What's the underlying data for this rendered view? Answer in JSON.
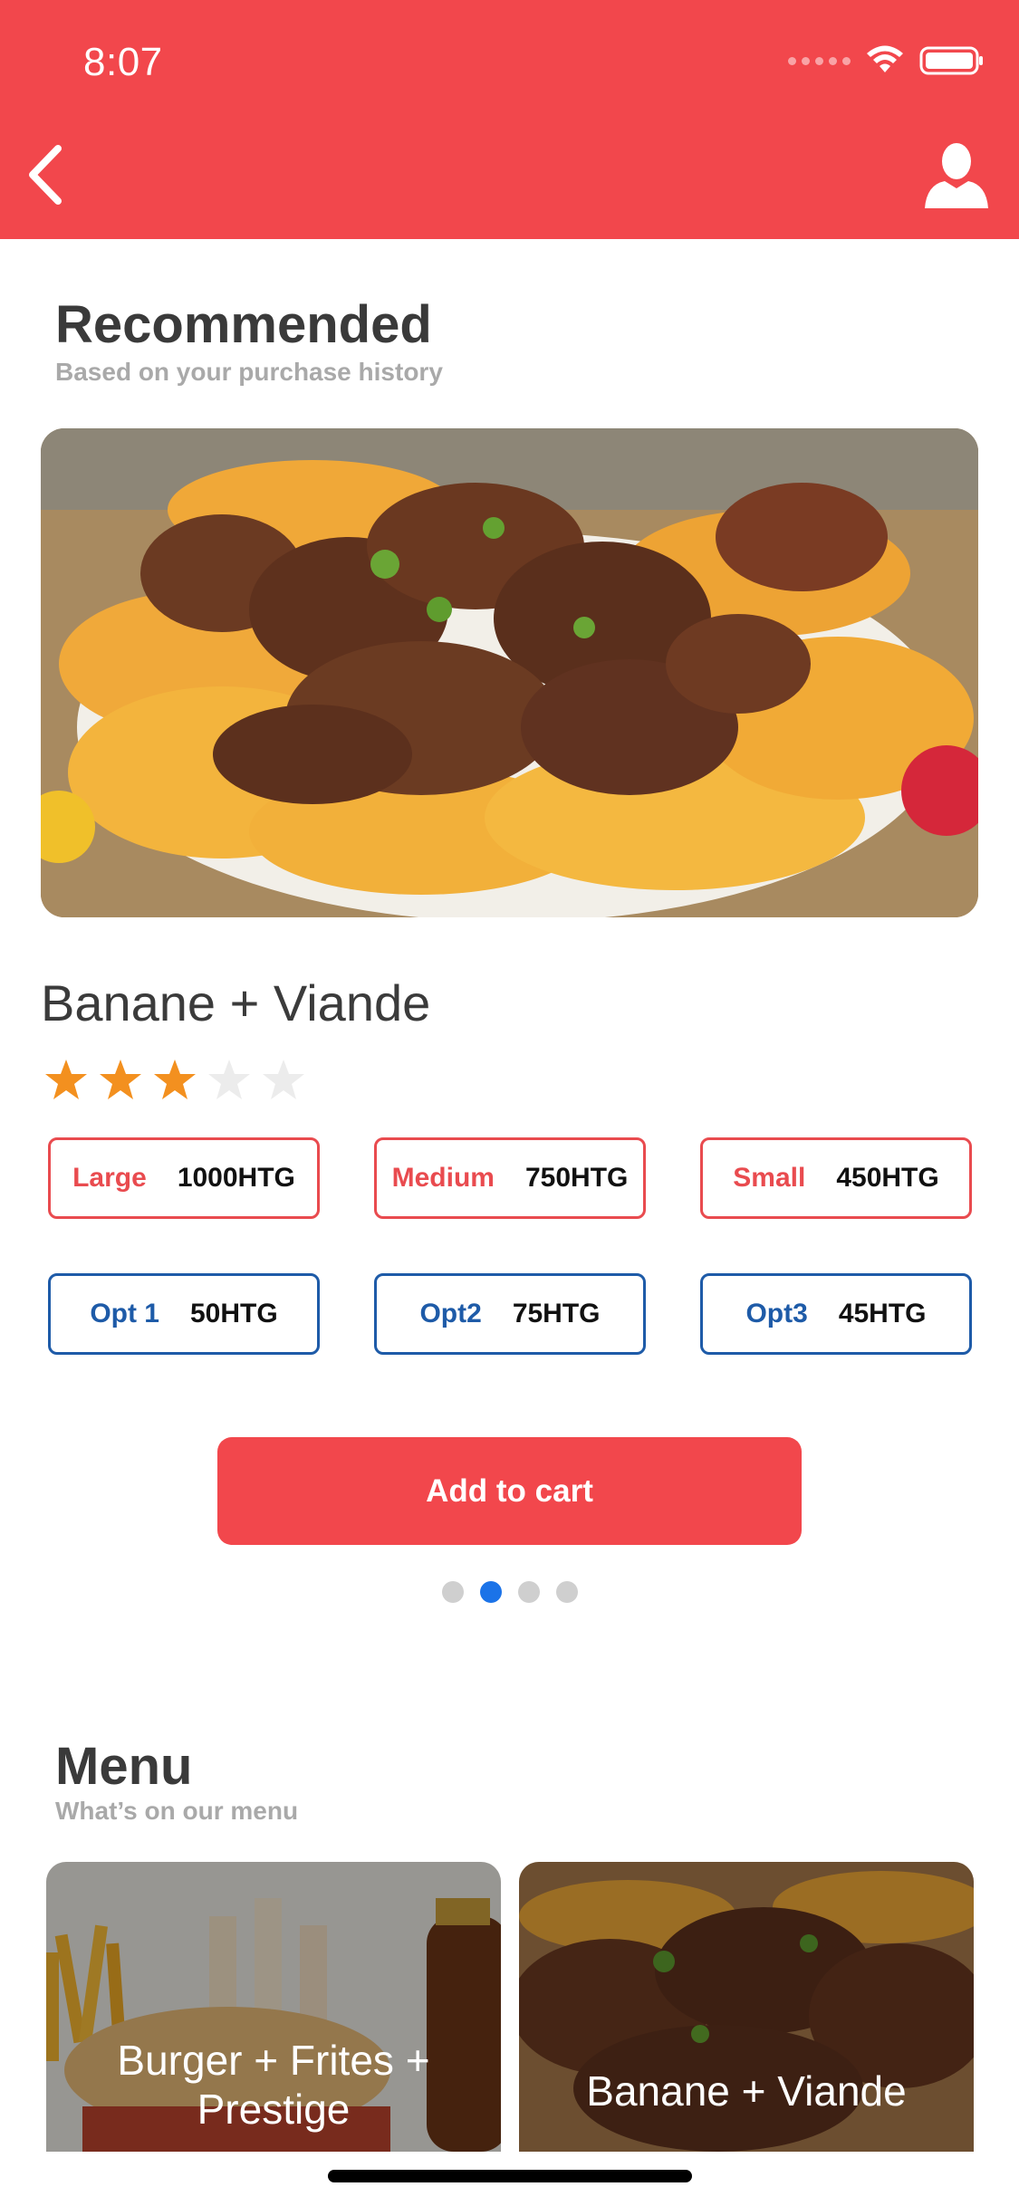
{
  "status_bar": {
    "time": "8:07"
  },
  "header": {
    "back_icon": "chevron-left-icon",
    "profile_icon": "user-icon",
    "color": "#F2474C"
  },
  "recommended": {
    "title": "Recommended",
    "subtitle": "Based on your purchase history",
    "item": {
      "name": "Banane + Viande",
      "rating": 3,
      "rating_max": 5,
      "sizes": [
        {
          "label": "Large",
          "price": "1000HTG"
        },
        {
          "label": "Medium",
          "price": "750HTG"
        },
        {
          "label": "Small",
          "price": "450HTG"
        }
      ],
      "options": [
        {
          "label": "Opt 1",
          "price": "50HTG"
        },
        {
          "label": "Opt2",
          "price": "75HTG"
        },
        {
          "label": "Opt3",
          "price": "45HTG"
        }
      ],
      "add_to_cart": "Add to cart"
    },
    "pager": {
      "count": 4,
      "active": 1
    }
  },
  "menu": {
    "title": "Menu",
    "subtitle": "What’s on our menu",
    "cards": [
      {
        "title": "Burger + Frites + Prestige"
      },
      {
        "title": "Banane + Viande"
      }
    ]
  },
  "colors": {
    "accent": "#F2474C",
    "size_border": "#E94B4F",
    "option_border": "#1E5BA8",
    "star": "#F3901F",
    "pager_active": "#1B73E8"
  }
}
